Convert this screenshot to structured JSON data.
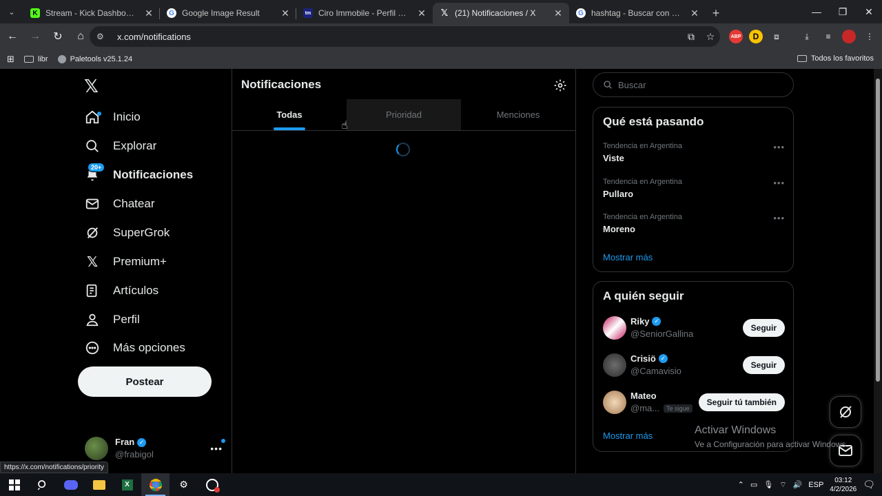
{
  "browser": {
    "tabs": [
      {
        "title": "Stream - Kick Dashboard",
        "icon": "kick-icon",
        "active": false
      },
      {
        "title": "Google Image Result",
        "icon": "google-icon",
        "active": false
      },
      {
        "title": "Ciro Immobile - Perfil del jugador",
        "icon": "site-icon",
        "active": false
      },
      {
        "title": "(21) Notificaciones / X",
        "icon": "x-icon",
        "active": true
      },
      {
        "title": "hashtag - Buscar con Google",
        "icon": "google-icon",
        "active": false
      }
    ],
    "url": "x.com/notifications",
    "bookmarks": [
      {
        "label": "libr"
      },
      {
        "label": "Paletools v25.1.24"
      }
    ],
    "bookmarks_right": "Todos los favoritos",
    "status_url": "https://x.com/notifications/priority"
  },
  "sidebar": {
    "items": [
      {
        "label": "Inicio",
        "icon": "home-icon"
      },
      {
        "label": "Explorar",
        "icon": "search-icon"
      },
      {
        "label": "Notificaciones",
        "icon": "bell-icon",
        "badge": "20+"
      },
      {
        "label": "Chatear",
        "icon": "mail-icon"
      },
      {
        "label": "SuperGrok",
        "icon": "grok-icon"
      },
      {
        "label": "Premium+",
        "icon": "x-icon"
      },
      {
        "label": "Artículos",
        "icon": "article-icon"
      },
      {
        "label": "Perfil",
        "icon": "person-icon"
      },
      {
        "label": "Más opciones",
        "icon": "more-circle-icon"
      }
    ],
    "post_label": "Postear",
    "account": {
      "name": "Fran",
      "handle": "@frabigol"
    }
  },
  "main": {
    "title": "Notificaciones",
    "tabs": [
      "Todas",
      "Prioridad",
      "Menciones"
    ],
    "active_tab": "Todas"
  },
  "right": {
    "search_placeholder": "Buscar",
    "trends_title": "Qué está pasando",
    "trends": [
      {
        "context": "Tendencia en Argentina",
        "name": "Viste"
      },
      {
        "context": "Tendencia en Argentina",
        "name": "Pullaro"
      },
      {
        "context": "Tendencia en Argentina",
        "name": "Moreno"
      }
    ],
    "show_more": "Mostrar más",
    "who_title": "A quién seguir",
    "who": [
      {
        "name": "Riky",
        "handle": "@SeniorGallina",
        "verified": true,
        "button": "Seguir"
      },
      {
        "name": "Crisiö",
        "handle": "@Camavisio",
        "verified": true,
        "button": "Seguir"
      },
      {
        "name": "Mateo",
        "handle": "@ma...",
        "verified": false,
        "follows_you": "Te sigue",
        "button": "Seguir tú también"
      }
    ],
    "who_show_more": "Mostrar más"
  },
  "watermark": {
    "line1": "Activar Windows",
    "line2": "Ve a Configuración para activar Windows."
  },
  "taskbar": {
    "lang": "ESP",
    "time": "03:12",
    "date": "4/2/2026"
  },
  "colors": {
    "accent": "#1d9bf0",
    "background": "#000000",
    "border": "#2f3336"
  }
}
